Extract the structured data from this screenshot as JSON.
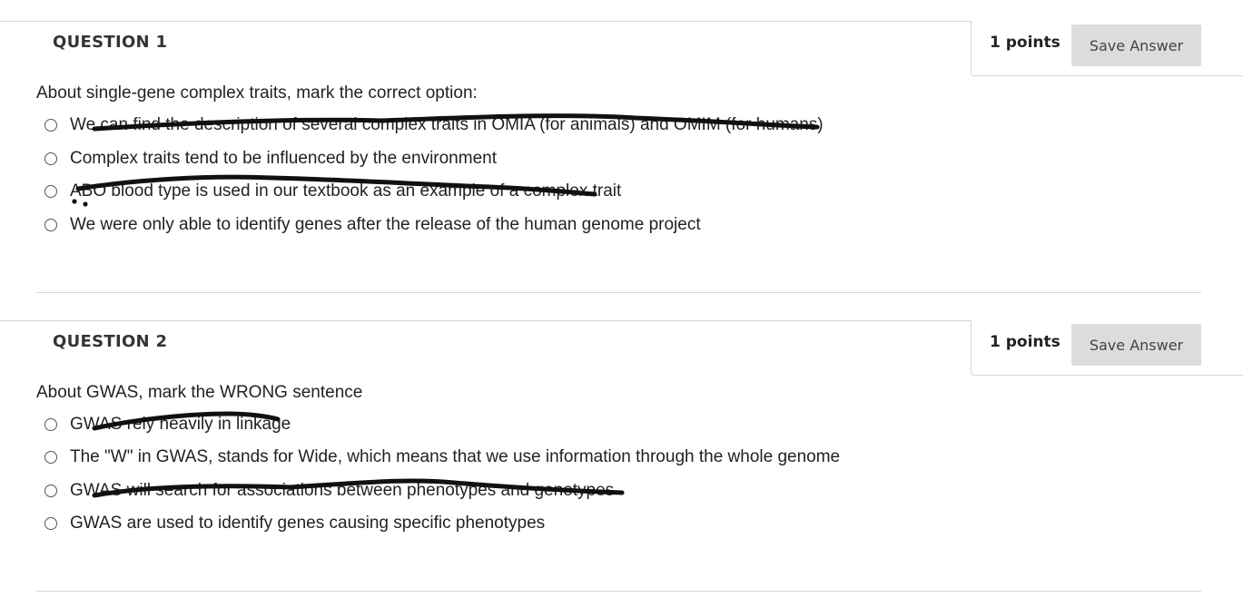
{
  "questions": [
    {
      "title": "QUESTION 1",
      "points": "1 points",
      "save_label": "Save Answer",
      "prompt": "About single-gene complex traits, mark the correct option:",
      "options": [
        "We can find the description of several complex traits in OMIA (for animals) and OMIM (for humans)",
        "Complex traits tend to be influenced by the environment",
        "ABO blood type is used in our textbook as an example of a complex trait",
        "We were only able to identify genes after the release of the human genome project"
      ]
    },
    {
      "title": "QUESTION 2",
      "points": "1 points",
      "save_label": "Save Answer",
      "prompt": "About GWAS, mark the WRONG sentence",
      "options": [
        "GWAS rely heavily in linkage",
        "The \"W\" in GWAS, stands for Wide, which means that we use information through the whole genome",
        "GWAS will search for associations between phenotypes and genotypes",
        "GWAS are used to identify genes causing specific phenotypes"
      ]
    }
  ]
}
